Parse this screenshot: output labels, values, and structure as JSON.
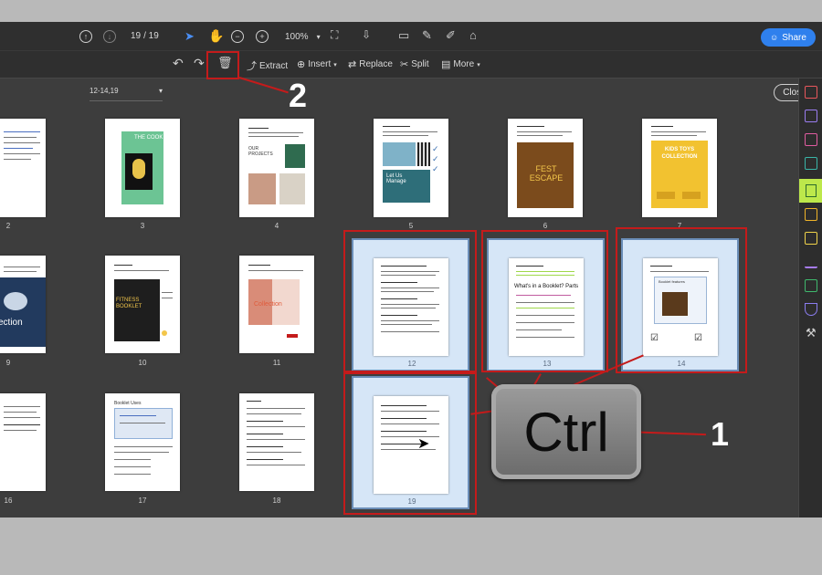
{
  "toolbar": {
    "page_current": "19",
    "page_total": "/ 19",
    "zoom": "100%",
    "share_label": "Share",
    "page_range": "12-14,19",
    "extract_label": "Extract",
    "insert_label": "Insert",
    "replace_label": "Replace",
    "split_label": "Split",
    "more_label": "More",
    "close_label": "Close"
  },
  "pages": [
    {
      "num": "2",
      "title": ""
    },
    {
      "num": "3",
      "title": "THE COOK"
    },
    {
      "num": "4",
      "title": "OUR PROJECTS"
    },
    {
      "num": "5",
      "title": "Let Us Manage"
    },
    {
      "num": "6",
      "title": "FEST ESCAPE"
    },
    {
      "num": "7",
      "title": "KIDS TOYS COLLECTION"
    },
    {
      "num": "9",
      "title": "ection"
    },
    {
      "num": "10",
      "title": "FITNESS BOOKLET"
    },
    {
      "num": "11",
      "title": "Collection"
    },
    {
      "num": "12",
      "title": ""
    },
    {
      "num": "13",
      "title": "What's in a Booklet? Parts"
    },
    {
      "num": "14",
      "title": "Booklet features"
    },
    {
      "num": "16",
      "title": ""
    },
    {
      "num": "17",
      "title": "Booklet Uses"
    },
    {
      "num": "18",
      "title": ""
    },
    {
      "num": "19",
      "title": ""
    }
  ],
  "overlay": {
    "key_label": "Ctrl",
    "step1": "1",
    "step2": "2"
  },
  "colors": {
    "accent": "#2f80ed",
    "annotation": "#c41b1b",
    "active_tool": "#bde84b"
  }
}
